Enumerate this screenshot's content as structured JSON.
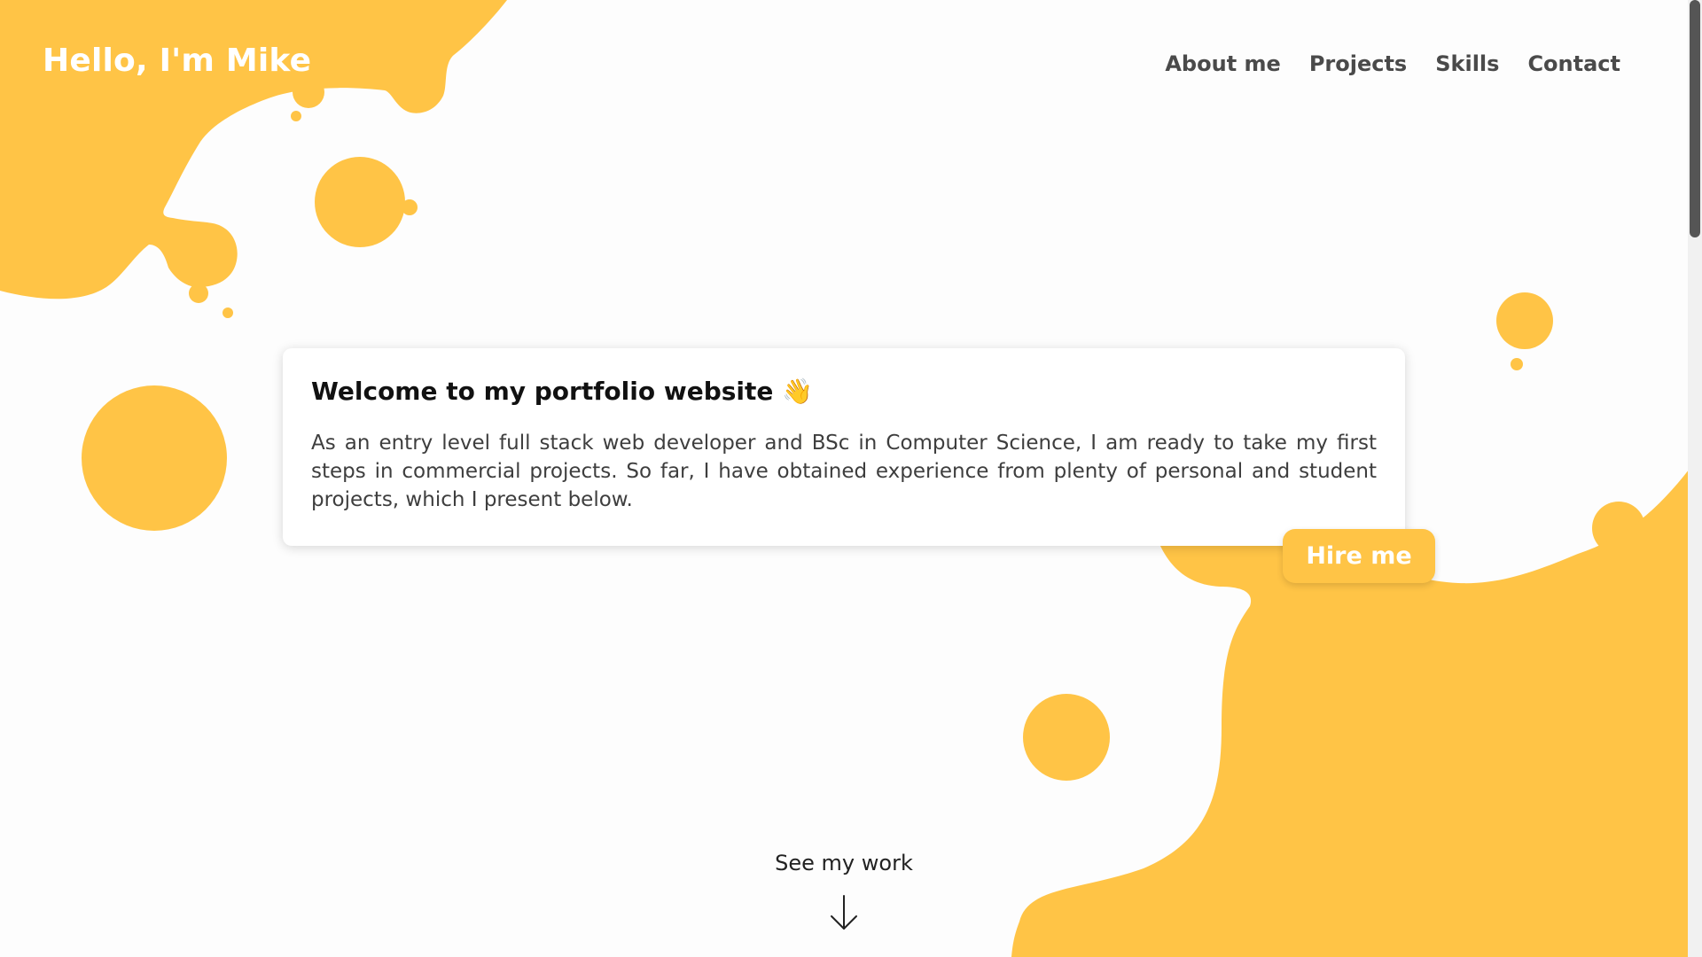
{
  "header": {
    "title": "Hello, I'm Mike"
  },
  "nav": {
    "items": [
      {
        "label": "About me"
      },
      {
        "label": "Projects"
      },
      {
        "label": "Skills"
      },
      {
        "label": "Contact"
      }
    ]
  },
  "welcome": {
    "heading": "Welcome to my portfolio website 👋",
    "body": "As an entry level full stack web developer and BSc in Computer Science, I am ready to take my first steps in commercial projects. So far, I have obtained experience from plenty of personal and student projects, which I present below."
  },
  "cta": {
    "hire_label": "Hire me",
    "see_work_label": "See my work"
  },
  "icons": {
    "scroll_arrow": "arrow-down-icon"
  },
  "colors": {
    "accent": "#ffc446",
    "nav_text": "#4a4a4a",
    "background": "#fdfdfd"
  }
}
